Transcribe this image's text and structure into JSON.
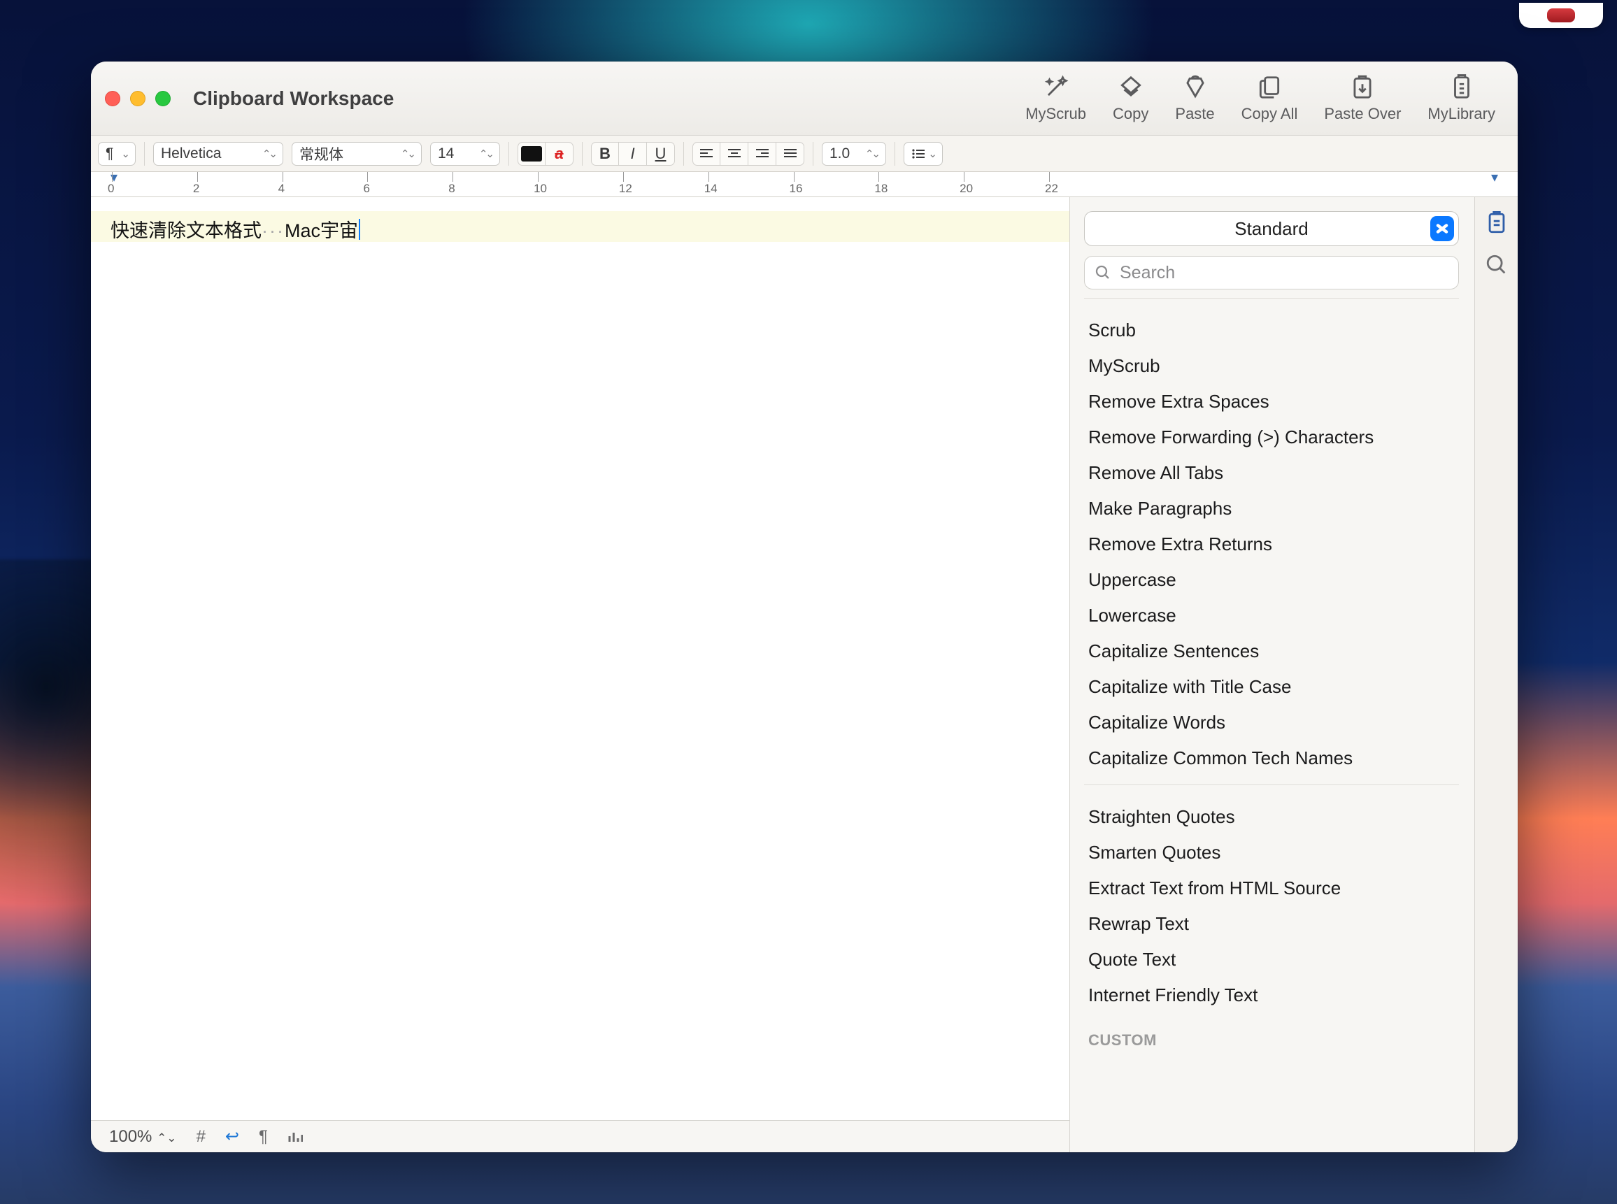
{
  "window": {
    "title": "Clipboard Workspace"
  },
  "toolbar": {
    "myScrub": "MyScrub",
    "copy": "Copy",
    "paste": "Paste",
    "copyAll": "Copy All",
    "pasteOver": "Paste Over",
    "myLibrary": "MyLibrary"
  },
  "format": {
    "paragraphGlyph": "¶",
    "font": "Helvetica",
    "style": "常规体",
    "size": "14",
    "lineSpacing": "1.0"
  },
  "ruler": {
    "ticks": [
      "0",
      "2",
      "4",
      "6",
      "8",
      "10",
      "12",
      "14",
      "16",
      "18",
      "20",
      "22"
    ]
  },
  "editor": {
    "text_a": "快速清除文本格式",
    "separator": "···",
    "text_b": "Mac宇宙"
  },
  "status": {
    "zoom": "100%",
    "hash": "#",
    "return": "↩",
    "para": "¶"
  },
  "sidebar": {
    "preset": "Standard",
    "searchPlaceholder": "Search",
    "group1": [
      "Scrub",
      "MyScrub",
      "Remove Extra Spaces",
      "Remove Forwarding (>) Characters",
      "Remove All Tabs",
      "Make Paragraphs",
      "Remove Extra Returns",
      "Uppercase",
      "Lowercase",
      "Capitalize Sentences",
      "Capitalize with Title Case",
      "Capitalize Words",
      "Capitalize Common Tech Names"
    ],
    "group2": [
      "Straighten Quotes",
      "Smarten Quotes",
      "Extract Text from HTML Source",
      "Rewrap Text",
      "Quote Text",
      "Internet Friendly Text"
    ],
    "customLabel": "CUSTOM"
  }
}
